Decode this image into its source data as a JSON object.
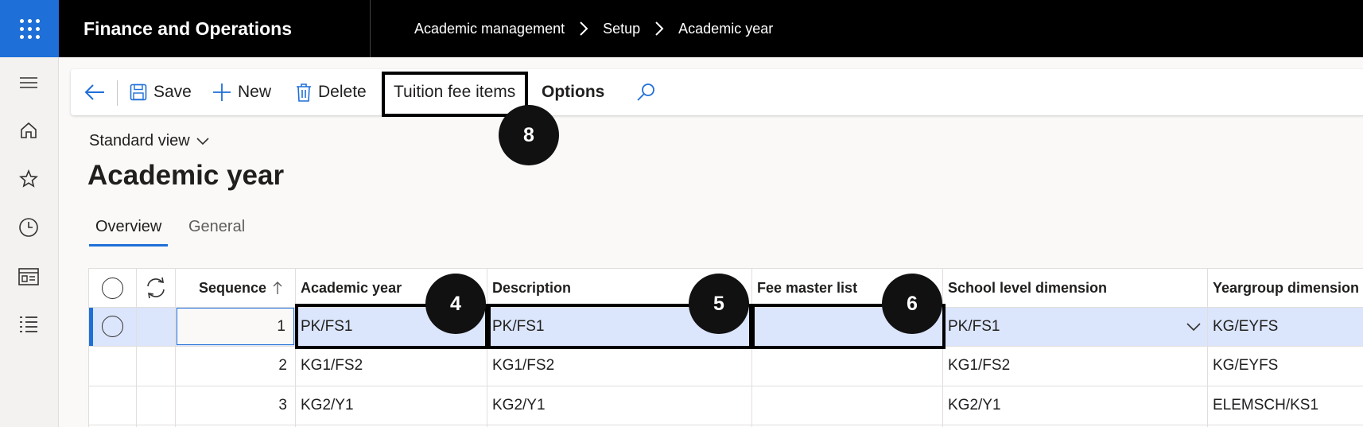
{
  "topbar": {
    "app_title": "Finance and Operations",
    "breadcrumb": [
      "Academic management",
      "Setup",
      "Academic year"
    ]
  },
  "leftnav": {
    "icons": [
      "hamburger-icon",
      "home-icon",
      "star-icon",
      "clock-icon",
      "workspace-icon",
      "list-icon"
    ]
  },
  "actionbar": {
    "back": "back-arrow-icon",
    "save": "Save",
    "new": "New",
    "delete": "Delete",
    "tuition_fee_items": "Tuition fee items",
    "options": "Options",
    "search": "search-icon"
  },
  "badges": {
    "b8": "8",
    "b4": "4",
    "b5": "5",
    "b6": "6"
  },
  "view": {
    "label": "Standard view"
  },
  "page": {
    "title": "Academic year"
  },
  "tabs": [
    {
      "label": "Overview",
      "active": true
    },
    {
      "label": "General",
      "active": false
    }
  ],
  "grid": {
    "columns": [
      "Sequence",
      "Academic year",
      "Description",
      "Fee master list",
      "School level dimension",
      "Yeargroup dimension"
    ],
    "rows": [
      {
        "sequence": "1",
        "academic_year": "PK/FS1",
        "description": "PK/FS1",
        "fee_master_list": "",
        "school_level": "PK/FS1",
        "yeargroup": "KG/EYFS"
      },
      {
        "sequence": "2",
        "academic_year": "KG1/FS2",
        "description": "KG1/FS2",
        "fee_master_list": "",
        "school_level": "KG1/FS2",
        "yeargroup": "KG/EYFS"
      },
      {
        "sequence": "3",
        "academic_year": "KG2/Y1",
        "description": "KG2/Y1",
        "fee_master_list": "",
        "school_level": "KG2/Y1",
        "yeargroup": "ELEMSCH/KS1"
      }
    ]
  },
  "colors": {
    "accent": "#1f6fd8",
    "selected_row": "#dbe5fb",
    "topbar": "#000000"
  }
}
